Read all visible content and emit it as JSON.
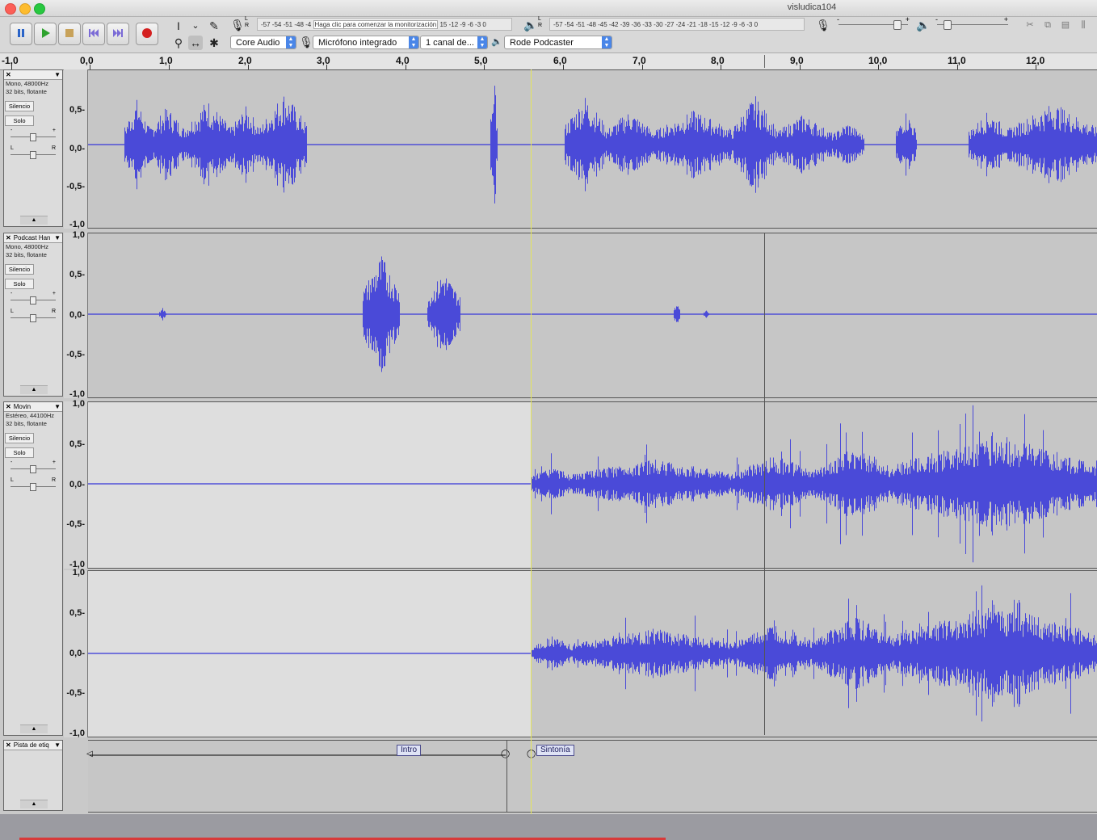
{
  "window": {
    "title": "visludica104"
  },
  "colors": {
    "waveform": "#4a4ad8",
    "playhead": "#e6e65a",
    "cursor_line": "#444444"
  },
  "transport": {
    "pause": "pause-icon",
    "play": "play-icon",
    "stop": "stop-icon",
    "skip_start": "skip-start-icon",
    "skip_end": "skip-end-icon",
    "record": "record-icon"
  },
  "meters": {
    "record_scale": "-57 -54 -51 -48 -4",
    "record_hint": "Haga clic para comenzar la monitorización",
    "record_scale_tail": "15 -12 -9 -6 -3 0",
    "playback_scale": "-57 -54 -51 -48 -45 -42 -39 -36 -33 -30 -27 -24 -21 -18 -15 -12 -9 -6 -3 0",
    "rec_L": "L",
    "rec_R": "R",
    "play_L": "L",
    "play_R": "R",
    "minus": "-",
    "plus": "+"
  },
  "device": {
    "host": "Core Audio",
    "mic": "Micrófono integrado",
    "channels": "1 canal de...",
    "output": "Rode Podcaster"
  },
  "ruler": [
    "-1,0",
    "0,0",
    "1,0",
    "2,0",
    "3,0",
    "4,0",
    "5,0",
    "6,0",
    "7,0",
    "8,0",
    "9,0",
    "10,0",
    "11,0",
    "12,0"
  ],
  "vscale_labels": [
    "1,0",
    "0,5-",
    "0,0-",
    "-0,5-",
    "-1,0"
  ],
  "tracks": [
    {
      "name": "",
      "info1": "Mono, 48000Hz",
      "info2": "32 bits, flotante",
      "mute": "Silencio",
      "solo": "Solo",
      "gain_min": "-",
      "gain_max": "+",
      "pan_l": "L",
      "pan_r": "R"
    },
    {
      "name": "Podcast Han",
      "info1": "Mono, 48000Hz",
      "info2": "32 bits, flotante",
      "mute": "Silencio",
      "solo": "Solo",
      "gain_min": "-",
      "gain_max": "+",
      "pan_l": "L",
      "pan_r": "R"
    },
    {
      "name": "Movin",
      "info1": "Estéreo, 44100Hz",
      "info2": "32 bits, flotante",
      "mute": "Silencio",
      "solo": "Solo",
      "gain_min": "-",
      "gain_max": "+",
      "pan_l": "L",
      "pan_r": "R"
    },
    {
      "name": "Pista de etiq"
    }
  ],
  "labels": [
    {
      "text": "Intro"
    },
    {
      "text": "Sintonía"
    }
  ]
}
